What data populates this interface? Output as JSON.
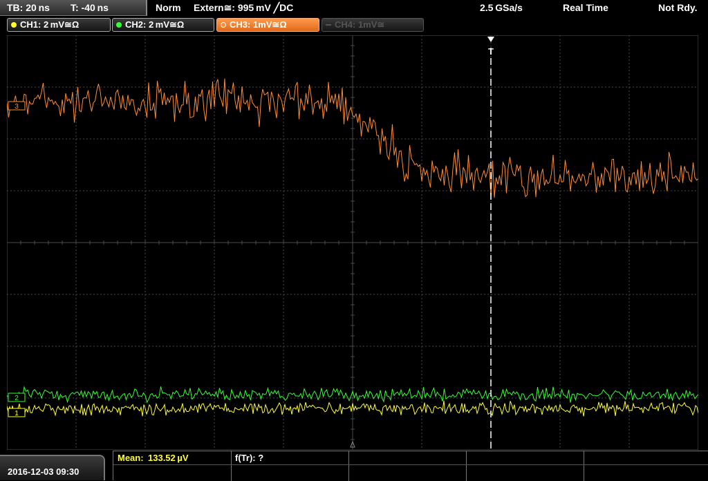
{
  "topbar": {
    "timebase": "TB: 20 ns",
    "trigger_time": "T: -40 ns",
    "mode": "Norm",
    "trigger_source": "Extern≅: 995 mV ╱DC",
    "sample_rate": "2.5 GSa/s",
    "acq_mode": "Real Time",
    "status": "Not Rdy."
  },
  "channels": [
    {
      "label": "CH1: 2 mV≅Ω",
      "color": "#ffff33",
      "state": "on"
    },
    {
      "label": "CH2: 2 mV≅Ω",
      "color": "#33ff33",
      "state": "on"
    },
    {
      "label": "CH3: 1mV≅Ω",
      "color": "#ff8c33",
      "state": "active"
    },
    {
      "label": "CH4: 1mV≅",
      "color": "#777777",
      "state": "off"
    }
  ],
  "markers": {
    "ch1": "1",
    "ch2": "2",
    "ch3": "3",
    "trigger": "T"
  },
  "measurements": {
    "mean_label": "Mean:",
    "mean_value": "133.52 µV",
    "freq_label": "f(Tr): ?"
  },
  "footer": {
    "datetime": "2016-12-03 09:30"
  },
  "colors": {
    "ch1": "#ffff33",
    "ch2": "#33ff33",
    "ch3": "#ff8c33",
    "grid": "#4a4a4a",
    "trigger": "#ffffff"
  }
}
